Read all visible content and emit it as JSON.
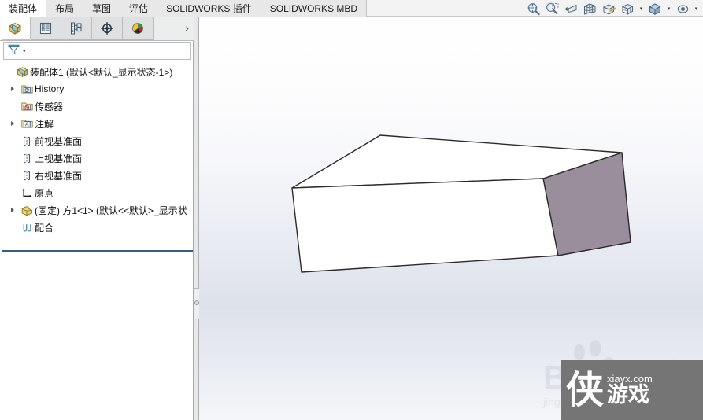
{
  "window": {
    "app": "SOLIDWORKS",
    "accent_color": "#f2c14b",
    "face_color_front": "#ffffff",
    "face_color_side": "#9a8e9c",
    "edge_color": "#2b2b2b",
    "rollback_color": "#2f5d8c"
  },
  "ribbon": {
    "tabs": [
      {
        "label": "装配体",
        "active": true
      },
      {
        "label": "布局",
        "active": false
      },
      {
        "label": "草图",
        "active": false
      },
      {
        "label": "评估",
        "active": false
      },
      {
        "label": "SOLIDWORKS 插件",
        "active": false
      },
      {
        "label": "SOLIDWORKS MBD",
        "active": false
      }
    ]
  },
  "view_toolbar": {
    "buttons": [
      {
        "name": "zoom-to-fit-icon",
        "title": "整屏显示全图"
      },
      {
        "name": "zoom-to-area-icon",
        "title": "局部放大"
      },
      {
        "name": "previous-view-icon",
        "title": "上一视图"
      },
      {
        "name": "section-view-icon",
        "title": "剖面视图"
      },
      {
        "name": "view-orientation-icon",
        "title": "视图定向"
      },
      {
        "name": "display-style-icon",
        "title": "显示样式",
        "has_caret": true
      },
      {
        "name": "hide-show-items-icon",
        "title": "隐藏/显示项目",
        "has_caret": true
      },
      {
        "name": "apply-scene-icon",
        "title": "编辑外观",
        "has_caret": true
      }
    ]
  },
  "manager_panel": {
    "tabs": [
      {
        "name": "feature-manager-tab",
        "label": "FeatureManager 设计树",
        "active": true
      },
      {
        "name": "property-manager-tab",
        "label": "PropertyManager",
        "active": false
      },
      {
        "name": "configuration-manager-tab",
        "label": "ConfigurationManager",
        "active": false
      },
      {
        "name": "dimxpert-manager-tab",
        "label": "DimXpertManager",
        "active": false
      },
      {
        "name": "display-manager-tab",
        "label": "DisplayManager",
        "active": false
      }
    ],
    "expand_label": "›",
    "filter": {
      "placeholder": "",
      "value": "",
      "icon": "filter-funnel-icon"
    }
  },
  "tree": {
    "nodes": [
      {
        "label": "装配体1  (默认<默认_显示状态-1>)",
        "icon": "assembly-icon",
        "indent": 0,
        "arrow": false
      },
      {
        "label": "History",
        "icon": "history-folder-icon",
        "indent": 1,
        "arrow": true
      },
      {
        "label": "传感器",
        "icon": "sensors-folder-icon",
        "indent": 1,
        "arrow": false
      },
      {
        "label": "注解",
        "icon": "annotations-folder-icon",
        "indent": 1,
        "arrow": true
      },
      {
        "label": "前视基准面",
        "icon": "plane-icon",
        "indent": 1,
        "arrow": false
      },
      {
        "label": "上视基准面",
        "icon": "plane-icon",
        "indent": 1,
        "arrow": false
      },
      {
        "label": "右视基准面",
        "icon": "plane-icon",
        "indent": 1,
        "arrow": false
      },
      {
        "label": "原点",
        "icon": "origin-icon",
        "indent": 1,
        "arrow": false
      },
      {
        "label": "(固定) 方1<1>  (默认<<默认>_显示状",
        "icon": "part-icon",
        "indent": 1,
        "arrow": true
      },
      {
        "label": "配合",
        "icon": "mates-icon",
        "indent": 1,
        "arrow": false
      }
    ]
  },
  "watermarks": {
    "baidu_text": "Baidu",
    "baidu_sub": "jingyan.baidu.com",
    "brand_char": "侠",
    "brand_url": "xiayx.com",
    "brand_sub": "游戏"
  },
  "model": {
    "name": "rectangular-block",
    "description": "白色长方体块，右侧面为淡紫色"
  }
}
